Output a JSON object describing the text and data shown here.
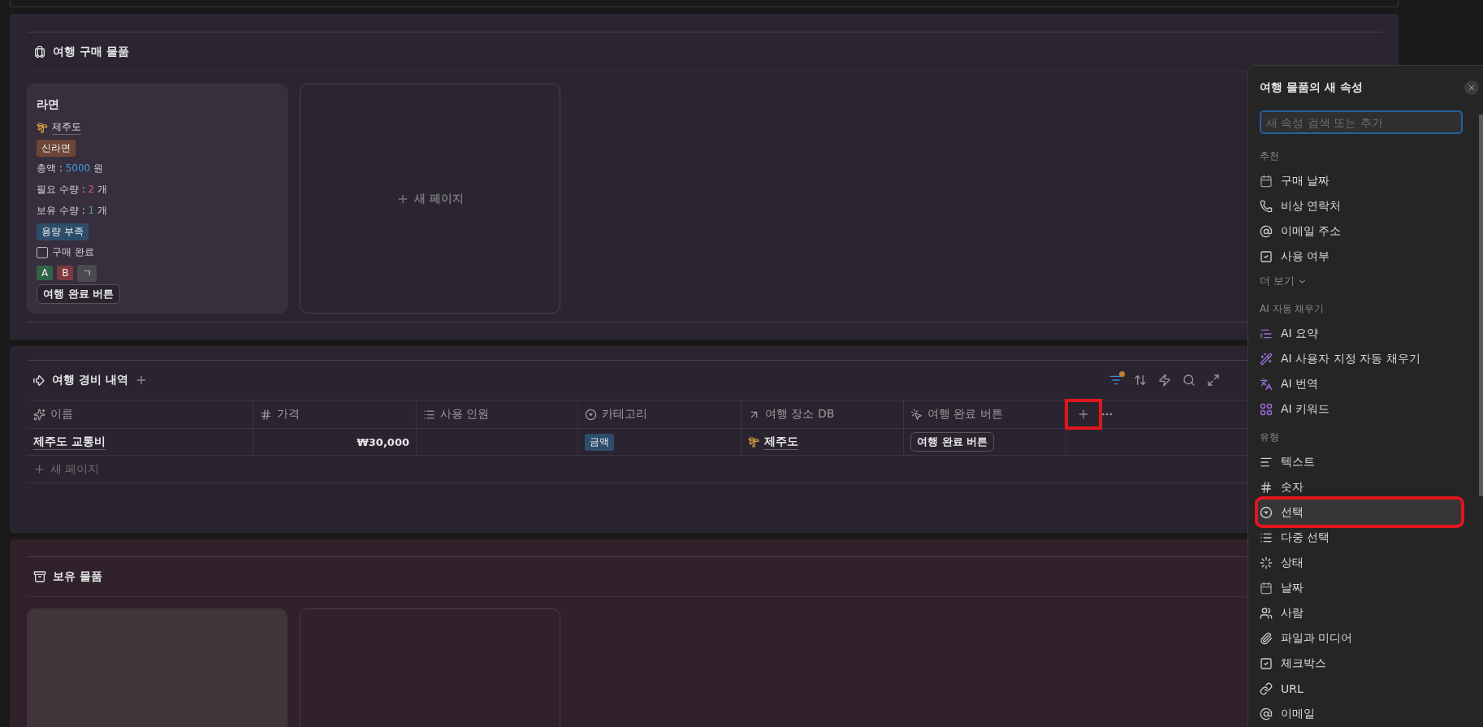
{
  "purchase_board": {
    "title": "여행 구매 물품",
    "cards": [
      {
        "title": "라면",
        "place": "제주도",
        "tag": {
          "label": "신라면",
          "color": "#6b4637"
        },
        "lines": [
          {
            "label": "총액 : ",
            "value": "5000",
            "unit": " 원",
            "color": "#3d9be0"
          },
          {
            "label": "필요 수량 : ",
            "value": "2",
            "unit": " 개",
            "color": "#d0508f"
          },
          {
            "label": "보유 수량 : ",
            "value": "1",
            "unit": " 개",
            "color": "#4aa872"
          }
        ],
        "status_tag": {
          "label": "용량 부족",
          "color": "#2d4e6b"
        },
        "checkbox": {
          "label": "구매 완료",
          "checked": false
        },
        "letter_tags": [
          {
            "label": "A",
            "color": "#2f6447"
          },
          {
            "label": "B",
            "color": "#7d3a3e"
          },
          {
            "label": "ㄱ",
            "color": "#4a4a4f"
          }
        ],
        "button": "여행 완료 버튼"
      }
    ],
    "new_page": "새 페이지"
  },
  "expense_table": {
    "title": "여행 경비 내역",
    "columns": [
      {
        "label": "이름",
        "kind": "title"
      },
      {
        "label": "가격",
        "kind": "number"
      },
      {
        "label": "사용 인원",
        "kind": "multi_select"
      },
      {
        "label": "카테고리",
        "kind": "select"
      },
      {
        "label": "여행 장소 DB",
        "kind": "relation"
      },
      {
        "label": "여행 완료 버튼",
        "kind": "button"
      }
    ],
    "add_column": {
      "highlighted": true
    },
    "rows": [
      {
        "name": "제주도 교통비",
        "price": "₩30,000",
        "category": {
          "label": "금액",
          "color": "#2d4e6b"
        },
        "place": "제주도",
        "button": "여행 완료 버튼"
      }
    ],
    "new_page": "새 페이지",
    "filter_active": true
  },
  "owned_board": {
    "title": "보유 물품"
  },
  "property_menu": {
    "title": "여행 물품의 새 속성",
    "search": {
      "placeholder": "새 속성 검색 또는 추가"
    },
    "sections": [
      {
        "heading": "추천",
        "more": "더 보기",
        "items": [
          {
            "label": "구매 날짜",
            "kind": "date",
            "selected": false,
            "highlighted": false
          },
          {
            "label": "비상 연락처",
            "kind": "phone",
            "selected": false,
            "highlighted": false
          },
          {
            "label": "이메일 주소",
            "kind": "email",
            "selected": false,
            "highlighted": false
          },
          {
            "label": "사용 여부",
            "kind": "checkbox",
            "selected": false,
            "highlighted": false
          }
        ]
      },
      {
        "heading": "AI 자동 채우기",
        "items": [
          {
            "label": "AI 요약",
            "kind": "ai_summary",
            "selected": false,
            "highlighted": false
          },
          {
            "label": "AI 사용자 지정 자동 채우기",
            "kind": "ai_custom",
            "selected": false,
            "highlighted": false
          },
          {
            "label": "AI 번역",
            "kind": "ai_translate",
            "selected": false,
            "highlighted": false
          },
          {
            "label": "AI 키워드",
            "kind": "ai_keywords",
            "selected": false,
            "highlighted": false
          }
        ]
      },
      {
        "heading": "유형",
        "items": [
          {
            "label": "텍스트",
            "kind": "text",
            "selected": false,
            "highlighted": false
          },
          {
            "label": "숫자",
            "kind": "number",
            "selected": false,
            "highlighted": false
          },
          {
            "label": "선택",
            "kind": "select",
            "selected": true,
            "highlighted": true
          },
          {
            "label": "다중 선택",
            "kind": "multi_select",
            "selected": false,
            "highlighted": false
          },
          {
            "label": "상태",
            "kind": "status",
            "selected": false,
            "highlighted": false
          },
          {
            "label": "날짜",
            "kind": "date",
            "selected": false,
            "highlighted": false
          },
          {
            "label": "사람",
            "kind": "person",
            "selected": false,
            "highlighted": false
          },
          {
            "label": "파일과 미디어",
            "kind": "files",
            "selected": false,
            "highlighted": false
          },
          {
            "label": "체크박스",
            "kind": "checkbox",
            "selected": false,
            "highlighted": false
          },
          {
            "label": "URL",
            "kind": "url",
            "selected": false,
            "highlighted": false
          },
          {
            "label": "이메일",
            "kind": "email",
            "selected": false,
            "highlighted": false
          }
        ]
      }
    ]
  }
}
